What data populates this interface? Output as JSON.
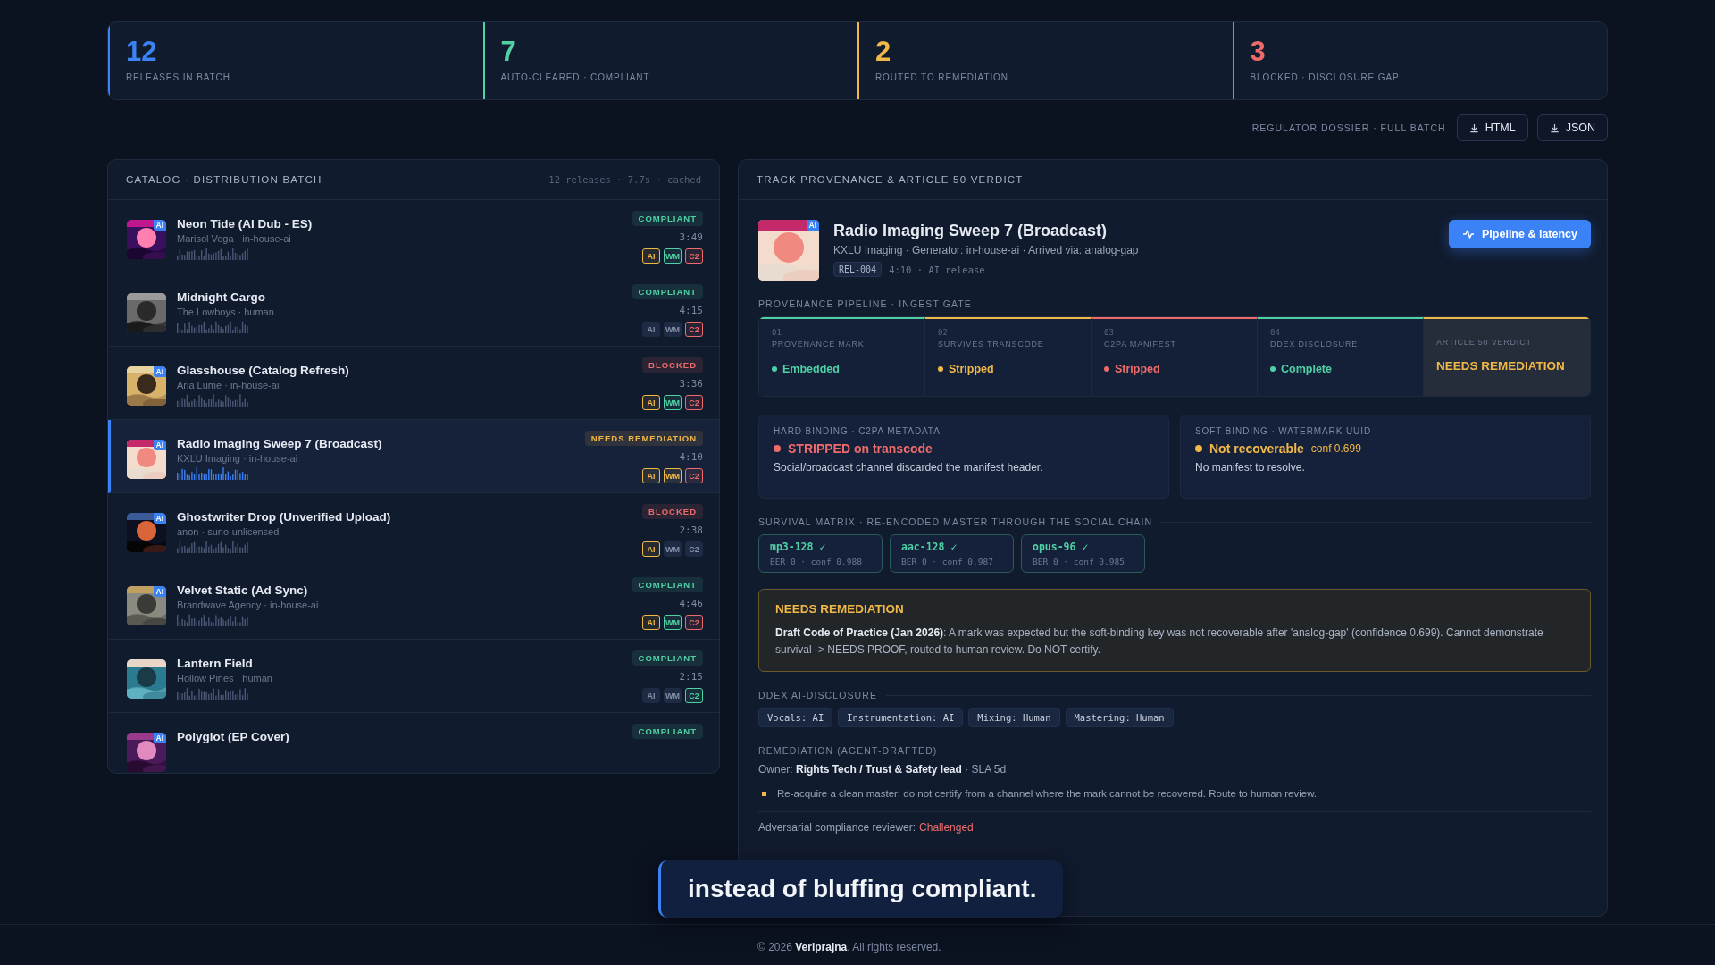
{
  "stats": [
    {
      "value": "12",
      "label": "RELEASES IN BATCH",
      "color": "#3b82f6"
    },
    {
      "value": "7",
      "label": "AUTO-CLEARED · COMPLIANT",
      "color": "#4fd1a5"
    },
    {
      "value": "2",
      "label": "ROUTED TO REMEDIATION",
      "color": "#f0b847"
    },
    {
      "value": "3",
      "label": "BLOCKED · DISCLOSURE GAP",
      "color": "#ef6b6b"
    }
  ],
  "dossier": {
    "label": "REGULATOR DOSSIER · FULL BATCH",
    "buttons": [
      "HTML",
      "JSON"
    ]
  },
  "catalog": {
    "title": "CATALOG · DISTRIBUTION BATCH",
    "meta": "12 releases · 7.7s · cached",
    "tracks": [
      {
        "title": "Neon Tide (AI Dub - ES)",
        "sub": "Marisol Vega · in-house-ai",
        "badge": "AI",
        "status": "COMPLIANT",
        "kind": "ok",
        "time": "3:49",
        "tags": [
          {
            "label": "AI",
            "kind": "warn"
          },
          {
            "label": "WM",
            "kind": "ok"
          },
          {
            "label": "C2",
            "kind": "fail"
          }
        ],
        "selected": false
      },
      {
        "title": "Midnight Cargo",
        "sub": "The Lowboys · human",
        "status": "COMPLIANT",
        "kind": "ok",
        "time": "4:15",
        "tags": [
          {
            "label": "AI",
            "kind": "off"
          },
          {
            "label": "WM",
            "kind": "off"
          },
          {
            "label": "C2",
            "kind": "fail"
          }
        ],
        "selected": false
      },
      {
        "title": "Glasshouse (Catalog Refresh)",
        "sub": "Aria Lume · in-house-ai",
        "badge": "AI",
        "status": "BLOCKED",
        "kind": "fail",
        "time": "3:36",
        "tags": [
          {
            "label": "AI",
            "kind": "warn"
          },
          {
            "label": "WM",
            "kind": "ok"
          },
          {
            "label": "C2",
            "kind": "fail"
          }
        ],
        "selected": false
      },
      {
        "title": "Radio Imaging Sweep 7 (Broadcast)",
        "sub": "KXLU Imaging · in-house-ai",
        "badge": "AI",
        "status": "NEEDS REMEDIATION",
        "kind": "warn",
        "time": "4:10",
        "tags": [
          {
            "label": "AI",
            "kind": "warn"
          },
          {
            "label": "WM",
            "kind": "warn"
          },
          {
            "label": "C2",
            "kind": "fail"
          }
        ],
        "selected": true
      },
      {
        "title": "Ghostwriter Drop (Unverified Upload)",
        "sub": "anon · suno-unlicensed",
        "badge": "AI",
        "status": "BLOCKED",
        "kind": "fail",
        "time": "2:38",
        "tags": [
          {
            "label": "AI",
            "kind": "warn"
          },
          {
            "label": "WM",
            "kind": "off"
          },
          {
            "label": "C2",
            "kind": "off"
          }
        ],
        "selected": false
      },
      {
        "title": "Velvet Static (Ad Sync)",
        "sub": "Brandwave Agency · in-house-ai",
        "badge": "AI",
        "status": "COMPLIANT",
        "kind": "ok",
        "time": "4:46",
        "tags": [
          {
            "label": "AI",
            "kind": "warn"
          },
          {
            "label": "WM",
            "kind": "ok"
          },
          {
            "label": "C2",
            "kind": "fail"
          }
        ],
        "selected": false
      },
      {
        "title": "Lantern Field",
        "sub": "Hollow Pines · human",
        "status": "COMPLIANT",
        "kind": "ok",
        "time": "2:15",
        "tags": [
          {
            "label": "AI",
            "kind": "off"
          },
          {
            "label": "WM",
            "kind": "off"
          },
          {
            "label": "C2",
            "kind": "ok"
          }
        ],
        "selected": false
      },
      {
        "title": "Polyglot (EP Cover)",
        "badge": "AI",
        "status": "COMPLIANT",
        "kind": "ok",
        "selected": false
      }
    ]
  },
  "detail": {
    "panel_title": "TRACK PROVENANCE & ARTICLE 50 VERDICT",
    "badge": "AI",
    "title": "Radio Imaging Sweep 7 (Broadcast)",
    "meta": "KXLU Imaging · Generator: in-house-ai · Arrived via: analog-gap",
    "id": "REL-004",
    "info": "4:10 · AI release",
    "action": "Pipeline & latency",
    "pipeline_label": "PROVENANCE PIPELINE · INGEST GATE",
    "stages": [
      {
        "num": "01",
        "label": "PROVENANCE MARK",
        "value": "Embedded",
        "kind": "ok"
      },
      {
        "num": "02",
        "label": "SURVIVES TRANSCODE",
        "value": "Stripped",
        "kind": "warn"
      },
      {
        "num": "03",
        "label": "C2PA MANIFEST",
        "value": "Stripped",
        "kind": "fail"
      },
      {
        "num": "04",
        "label": "DDEX DISCLOSURE",
        "value": "Complete",
        "kind": "ok"
      }
    ],
    "verdict": {
      "label": "ARTICLE 50 VERDICT",
      "value": "NEEDS REMEDIATION"
    },
    "bindings": [
      {
        "title": "HARD BINDING · C2PA METADATA",
        "status": "STRIPPED on transcode",
        "kind": "fail",
        "text": "Social/broadcast channel discarded the manifest header."
      },
      {
        "title": "SOFT BINDING · WATERMARK UUID",
        "status": "Not recoverable",
        "conf": "conf 0.699",
        "kind": "warn",
        "text": "No manifest to resolve."
      }
    ],
    "survival_label": "SURVIVAL MATRIX · RE-ENCODED MASTER THROUGH THE SOCIAL CHAIN",
    "survival": [
      {
        "codec": "mp3-128 ✓",
        "detail": "BER 0 · conf 0.988"
      },
      {
        "codec": "aac-128 ✓",
        "detail": "BER 0 · conf 0.987"
      },
      {
        "codec": "opus-96 ✓",
        "detail": "BER 0 · conf 0.985"
      }
    ],
    "notice": {
      "title": "NEEDS REMEDIATION",
      "text": "**Draft Code of Practice (Jan 2026)**: A mark was expected but the soft-binding key was not recoverable after 'analog-gap' (confidence 0.699). Cannot demonstrate survival -> NEEDS PROOF, routed to human review. Do NOT certify."
    },
    "ddex_label": "DDEX AI-DISCLOSURE",
    "ddex": [
      "Vocals: AI",
      "Instrumentation: AI",
      "Mixing: Human",
      "Mastering: Human"
    ],
    "remediation_label": "REMEDIATION (AGENT-DRAFTED)",
    "owner": "Owner: **Rights Tech / Trust & Safety lead** · SLA 5d",
    "steps": [
      "Re-acquire a clean master; do not certify from a channel where the mark cannot be recovered. Route to human review."
    ],
    "reviewer": {
      "label": "Adversarial compliance reviewer:",
      "value": "Challenged"
    }
  },
  "caption": "instead of bluffing compliant.",
  "footer": "© 2026 **Veriprajna**. All rights reserved."
}
